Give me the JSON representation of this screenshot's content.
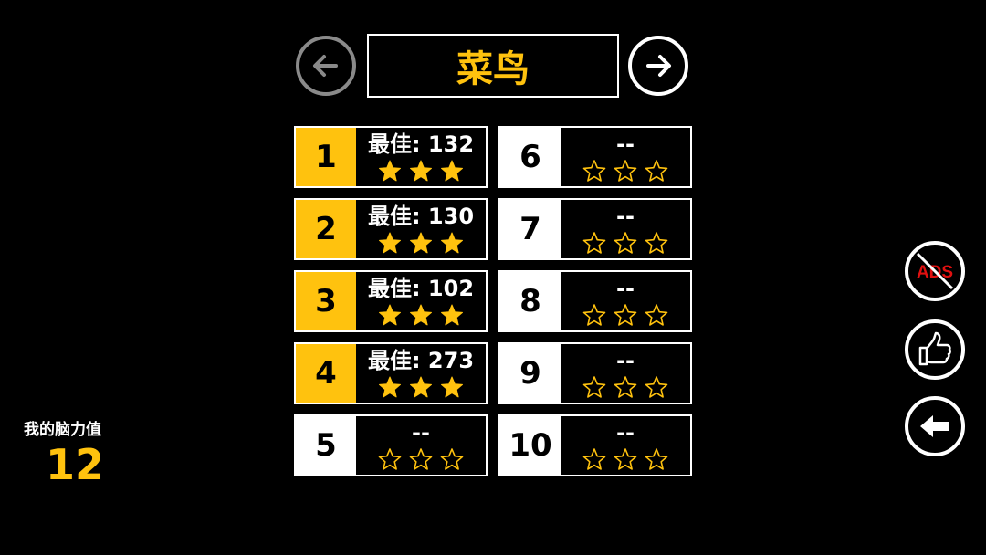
{
  "header": {
    "title": "菜鸟",
    "prev_icon": "arrow-left-icon",
    "next_icon": "arrow-right-icon"
  },
  "colors": {
    "accent": "#ffc20e",
    "background": "#000000",
    "foreground": "#ffffff",
    "disabled": "#8a8a8a"
  },
  "levels": [
    {
      "number": "1",
      "best": "最佳: 132",
      "stars_earned": 3,
      "completed": true
    },
    {
      "number": "2",
      "best": "最佳: 130",
      "stars_earned": 3,
      "completed": true
    },
    {
      "number": "3",
      "best": "最佳: 102",
      "stars_earned": 3,
      "completed": true
    },
    {
      "number": "4",
      "best": "最佳: 273",
      "stars_earned": 3,
      "completed": true
    },
    {
      "number": "5",
      "best": "--",
      "stars_earned": 0,
      "completed": false
    },
    {
      "number": "6",
      "best": "--",
      "stars_earned": 0,
      "completed": false
    },
    {
      "number": "7",
      "best": "--",
      "stars_earned": 0,
      "completed": false
    },
    {
      "number": "8",
      "best": "--",
      "stars_earned": 0,
      "completed": false
    },
    {
      "number": "9",
      "best": "--",
      "stars_earned": 0,
      "completed": false
    },
    {
      "number": "10",
      "best": "--",
      "stars_earned": 0,
      "completed": false
    }
  ],
  "brain": {
    "label": "我的脑力值",
    "value": "12"
  },
  "side_buttons": {
    "no_ads_label": "ADS",
    "no_ads_icon": "no-ads-icon",
    "like_icon": "thumbs-up-icon",
    "back_icon": "back-arrow-icon"
  }
}
